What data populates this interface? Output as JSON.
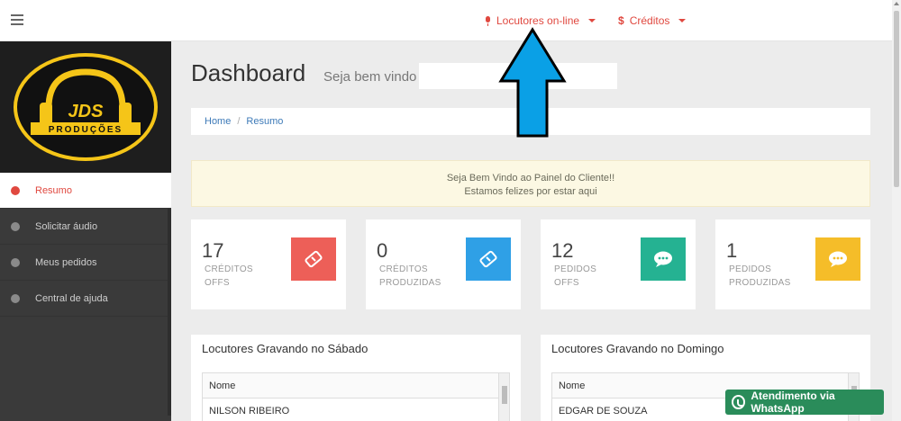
{
  "topbar": {
    "speakers_label": "Locutores on-line",
    "credits_label": "Créditos",
    "credits_symbol": "$"
  },
  "logo": {
    "line1": "JDS",
    "line2": "PRODUÇÕES"
  },
  "sidebar": {
    "items": [
      {
        "label": "Resumo",
        "active": true
      },
      {
        "label": "Solicitar áudio"
      },
      {
        "label": "Meus pedidos"
      },
      {
        "label": "Central de ajuda"
      }
    ]
  },
  "header": {
    "title": "Dashboard",
    "subtitle": "Seja bem vindo"
  },
  "breadcrumb": {
    "home": "Home",
    "separator": "/",
    "current": "Resumo"
  },
  "notice": {
    "line1": "Seja Bem Vindo ao Painel do Cliente!!",
    "line2": "Estamos felizes por estar aqui"
  },
  "cards": [
    {
      "value": "17",
      "label1": "CRÉDITOS",
      "label2": "OFFS",
      "icon": "ticket-icon",
      "color": "#ed5f58"
    },
    {
      "value": "0",
      "label1": "CRÉDITOS",
      "label2": "PRODUZIDAS",
      "icon": "ticket-icon",
      "color": "#2fa0e6"
    },
    {
      "value": "12",
      "label1": "PEDIDOS",
      "label2": "OFFS",
      "icon": "chat-icon",
      "color": "#25b292"
    },
    {
      "value": "1",
      "label1": "PEDIDOS",
      "label2": "PRODUZIDAS",
      "icon": "chat-icon",
      "color": "#f5bd29"
    }
  ],
  "panels": [
    {
      "title": "Locutores Gravando no Sábado",
      "column": "Nome",
      "rows": [
        "NILSON RIBEIRO"
      ]
    },
    {
      "title": "Locutores Gravando no Domingo",
      "column": "Nome",
      "rows": [
        "EDGAR DE SOUZA"
      ]
    }
  ],
  "whatsapp": {
    "label": "Atendimento via WhatsApp"
  },
  "colors": {
    "accent": "#e0483f",
    "annotation_arrow": "#0aa0e6"
  }
}
